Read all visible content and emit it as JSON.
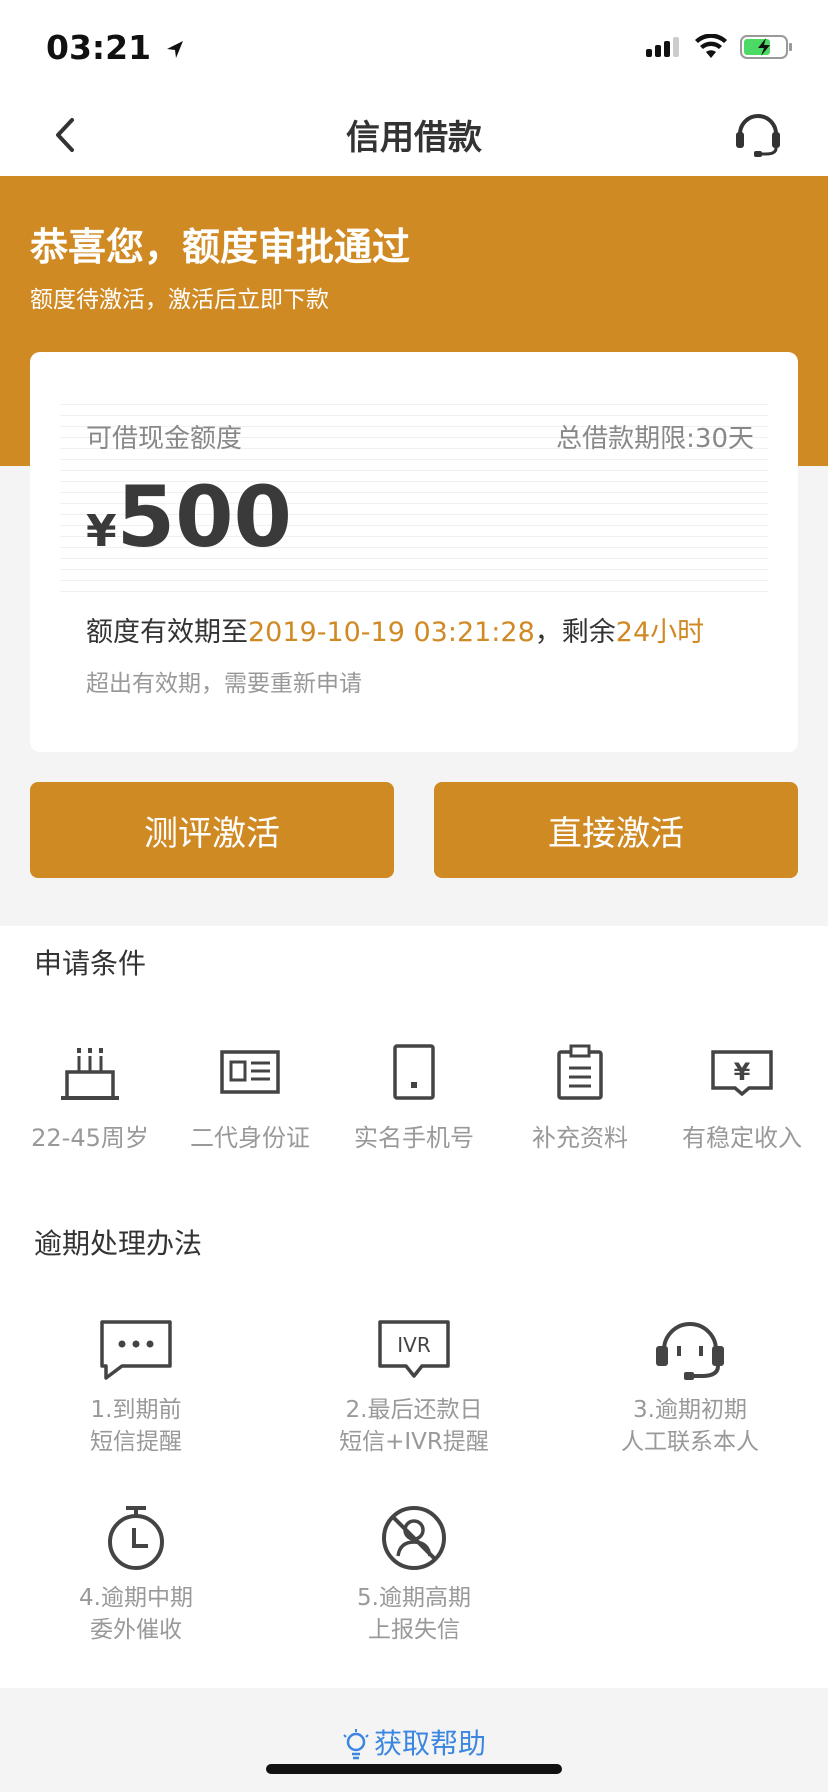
{
  "status_bar": {
    "time": "03:21"
  },
  "nav": {
    "title": "信用借款",
    "back_icon": "back-chevron-icon",
    "service_icon": "headset-icon"
  },
  "hero": {
    "title": "恭喜您，额度审批通过",
    "subtitle": "额度待激活，激活后立即下款",
    "color": "#d08a24"
  },
  "card": {
    "amount_label": "可借现金额度",
    "term_label": "总借款期限:30天",
    "currency": "¥",
    "amount": "500",
    "validity_prefix": "额度有效期至",
    "validity_date": "2019-10-19 03:21:28",
    "validity_mid": "，剩余",
    "validity_remaining": "24小时",
    "expire_note": "超出有效期，需要重新申请"
  },
  "buttons": {
    "evaluate": "测评激活",
    "direct": "直接激活"
  },
  "conditions": {
    "title": "申请条件",
    "items": [
      {
        "label": "22-45周岁",
        "icon": "birthday-cake-icon"
      },
      {
        "label": "二代身份证",
        "icon": "id-card-icon"
      },
      {
        "label": "实名手机号",
        "icon": "phone-icon"
      },
      {
        "label": "补充资料",
        "icon": "clipboard-icon"
      },
      {
        "label": "有稳定收入",
        "icon": "income-icon"
      }
    ]
  },
  "overdue": {
    "title": "逾期处理办法",
    "items": [
      {
        "line1": "1.到期前",
        "line2": "短信提醒",
        "icon": "sms-icon"
      },
      {
        "line1": "2.最后还款日",
        "line2": "短信+IVR提醒",
        "icon": "ivr-icon"
      },
      {
        "line1": "3.逾期初期",
        "line2": "人工联系本人",
        "icon": "agent-headset-icon"
      },
      {
        "line1": "4.逾期中期",
        "line2": "委外催收",
        "icon": "stopwatch-icon"
      },
      {
        "line1": "5.逾期高期",
        "line2": "上报失信",
        "icon": "prohibited-person-icon"
      }
    ]
  },
  "help": {
    "label": "获取帮助",
    "icon": "lightbulb-icon"
  }
}
